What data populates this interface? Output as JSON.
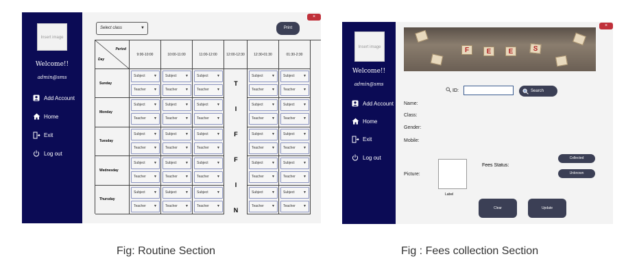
{
  "routine": {
    "close_label": "×",
    "image_placeholder": "Insert image",
    "welcome": "Welcome!!",
    "admin": "admin@sms",
    "nav": [
      {
        "label": "Add Account",
        "icon": "account-icon"
      },
      {
        "label": "Home",
        "icon": "home-icon"
      },
      {
        "label": "Exit",
        "icon": "exit-icon"
      },
      {
        "label": "Log out",
        "icon": "power-icon"
      }
    ],
    "select_class": "Select class",
    "print_label": "Print",
    "corner_period": "Period",
    "corner_day": "Day",
    "times": [
      "9:00-10:00",
      "10:00-11:00",
      "11:00-12:00",
      "12:00-12:30",
      "12:30-01:30",
      "01:30-2:30"
    ],
    "days": [
      "Sunday",
      "Monday",
      "Tuesday",
      "Wednesday",
      "Thursday"
    ],
    "subject_label": "Subject",
    "teacher_label": "Teacher",
    "tiffin": [
      "T",
      "I",
      "F",
      "F",
      "I",
      "N"
    ]
  },
  "fees": {
    "close_label": "×",
    "image_placeholder": "Insert image",
    "welcome": "Welcome!!",
    "admin": "admin@sms",
    "nav": [
      {
        "label": "Add Account",
        "icon": "account-icon"
      },
      {
        "label": "Home",
        "icon": "home-icon"
      },
      {
        "label": "Exit",
        "icon": "exit-icon"
      },
      {
        "label": "Log out",
        "icon": "power-icon"
      }
    ],
    "banner_letters": [
      "F",
      "E",
      "E",
      "S"
    ],
    "id_label": "ID:",
    "search_label": "Search",
    "fields": [
      "Name:",
      "Class:",
      "Gender:",
      "Mobile:"
    ],
    "picture_label": "Picture:",
    "picture_caption": "Label",
    "fees_status_label": "Fees Status:",
    "collected_label": "Collected",
    "unknown_label": "Unknown",
    "clear_label": "Clear",
    "update_label": "Update"
  },
  "captions": {
    "routine": "Fig: Routine Section",
    "fees": "Fig : Fees collection Section"
  }
}
